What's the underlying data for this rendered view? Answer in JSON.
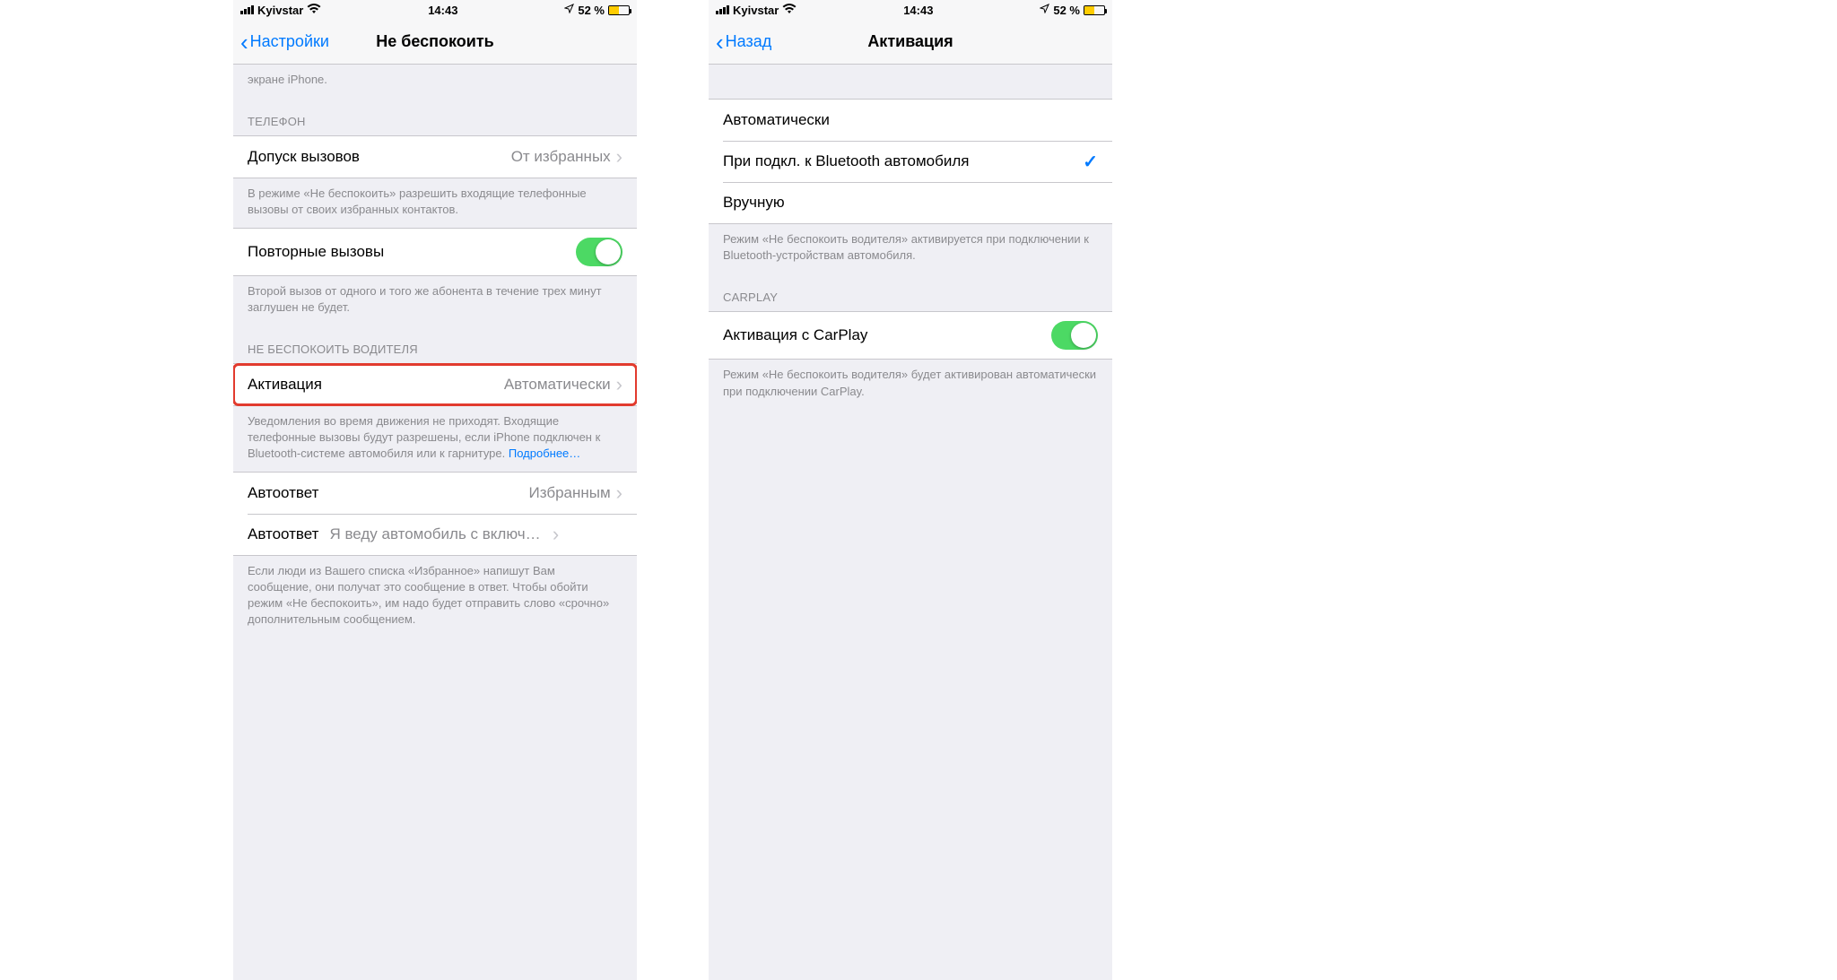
{
  "status": {
    "carrier": "Kyivstar",
    "time": "14:43",
    "battery_pct": "52 %"
  },
  "screen1": {
    "back_label": "Настройки",
    "title": "Не беспокоить",
    "top_footer": "экране iPhone.",
    "phone_header": "ТЕЛЕФОН",
    "allow_calls_label": "Допуск вызовов",
    "allow_calls_value": "От избранных",
    "allow_calls_footer": "В режиме «Не беспокоить» разрешить входящие телефонные вызовы от своих избранных контактов.",
    "repeat_label": "Повторные вызовы",
    "repeat_footer": "Второй вызов от одного и того же абонента в течение трех минут заглушен не будет.",
    "driver_header": "НЕ БЕСПОКОИТЬ ВОДИТЕЛЯ",
    "activation_label": "Активация",
    "activation_value": "Автоматически",
    "activation_footer": "Уведомления во время движения не приходят. Входящие телефонные вызовы будут разрешены, если iPhone подключен к Bluetooth-системе автомобиля или к гарнитуре. ",
    "activation_more": "Подробнее…",
    "autoreply_label": "Автоответ",
    "autoreply_value": "Избранным",
    "autoreply_msg_label": "Автоответ",
    "autoreply_msg_value": "Я веду автомобиль с включенной…",
    "autoreply_footer": "Если люди из Вашего списка «Избранное» напишут Вам сообщение, они получат это сообщение в ответ. Чтобы обойти режим «Не беспокоить», им надо будет отправить слово «срочно» дополнительным сообщением."
  },
  "screen2": {
    "back_label": "Назад",
    "title": "Активация",
    "opt_auto": "Автоматически",
    "opt_bluetooth": "При подкл. к Bluetooth автомобиля",
    "opt_manual": "Вручную",
    "options_footer": "Режим «Не беспокоить водителя» активируется при подключении к Bluetooth-устройствам автомобиля.",
    "carplay_header": "CARPLAY",
    "carplay_label": "Активация с CarPlay",
    "carplay_footer": "Режим «Не беспокоить водителя» будет активирован автоматически при подключении CarPlay."
  }
}
